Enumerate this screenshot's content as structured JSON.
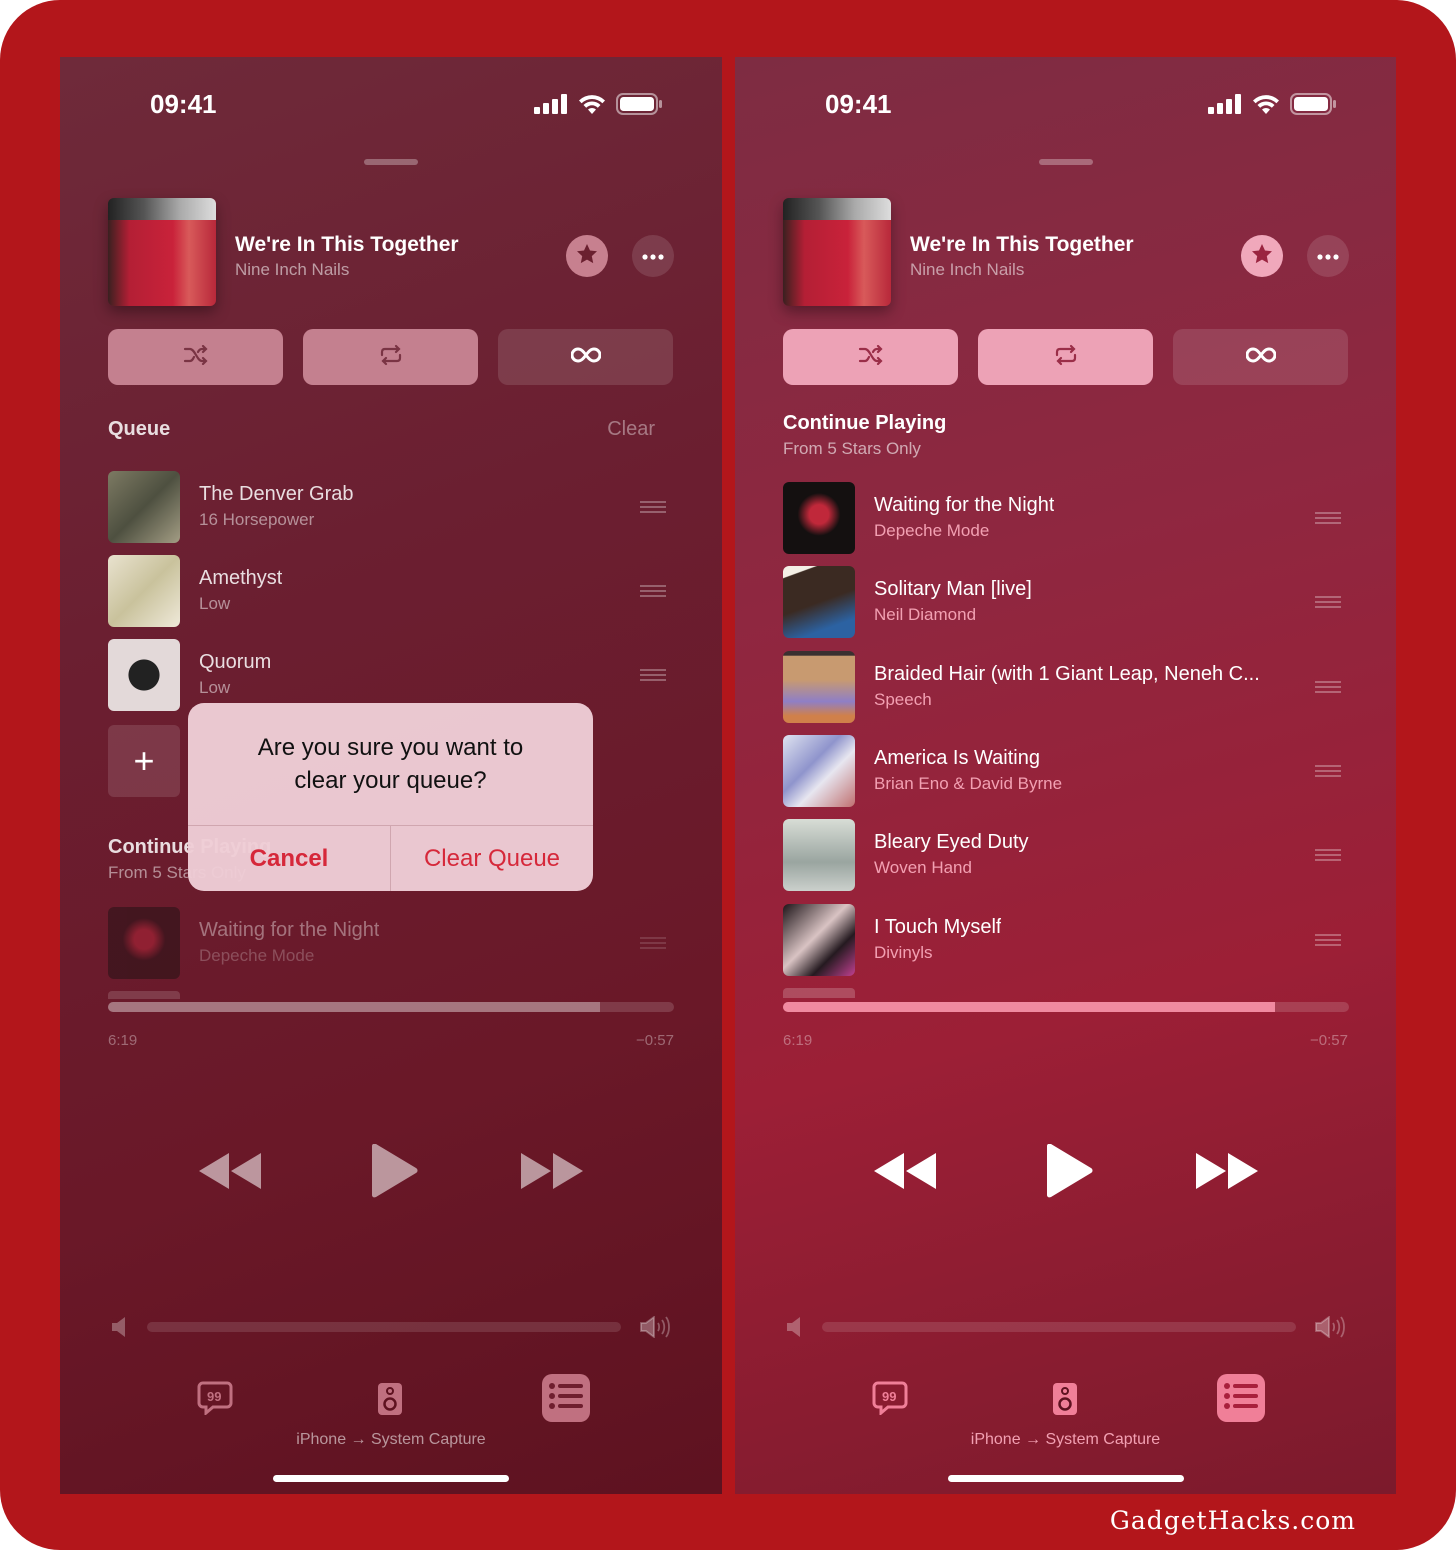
{
  "watermark": "GadgetHacks.com",
  "panels": [
    {
      "status_time": "09:41",
      "now_playing": {
        "title": "We're In This Together",
        "artist": "Nine Inch Nails"
      },
      "modes": {
        "shuffle_active": false,
        "repeat_active": false,
        "autoplay_active": false
      },
      "queue_header": "Queue",
      "clear_label": "Clear",
      "queue": [
        {
          "title": "The Denver Grab",
          "artist": "16 Horsepower"
        },
        {
          "title": "Amethyst",
          "artist": "Low"
        },
        {
          "title": "Quorum",
          "artist": "Low"
        }
      ],
      "add_label": "+",
      "continue_header": "Continue Playing",
      "continue_sub": "From 5 Stars Only",
      "continue_list": [
        {
          "title": "Waiting for the Night",
          "artist": "Depeche Mode"
        }
      ],
      "progress": {
        "elapsed": "6:19",
        "remaining": "−0:57",
        "fraction": 0.87
      },
      "volume_fraction": 0.0,
      "route_label": "iPhone → System Capture",
      "dialog": {
        "message": "Are you sure you want to clear your queue?",
        "cancel": "Cancel",
        "confirm": "Clear Queue"
      }
    },
    {
      "status_time": "09:41",
      "now_playing": {
        "title": "We're In This Together",
        "artist": "Nine Inch Nails"
      },
      "modes": {
        "shuffle_active": true,
        "repeat_active": true,
        "autoplay_active": false
      },
      "continue_header": "Continue Playing",
      "continue_sub": "From 5 Stars Only",
      "continue_list": [
        {
          "title": "Waiting for the Night",
          "artist": "Depeche Mode"
        },
        {
          "title": "Solitary Man [live]",
          "artist": "Neil Diamond"
        },
        {
          "title": "Braided Hair (with 1 Giant Leap, Neneh C...",
          "artist": "Speech"
        },
        {
          "title": "America Is Waiting",
          "artist": "Brian Eno & David Byrne"
        },
        {
          "title": "Bleary Eyed Duty",
          "artist": "Woven Hand"
        },
        {
          "title": "I Touch Myself",
          "artist": "Divinyls"
        }
      ],
      "progress": {
        "elapsed": "6:19",
        "remaining": "−0:57",
        "fraction": 0.87
      },
      "volume_fraction": 0.0,
      "route_label": "iPhone → System Capture"
    }
  ],
  "colors": {
    "frame": "#b3161b",
    "accent_pink": "#f08aa0",
    "dialog_button": "#d6283a"
  }
}
